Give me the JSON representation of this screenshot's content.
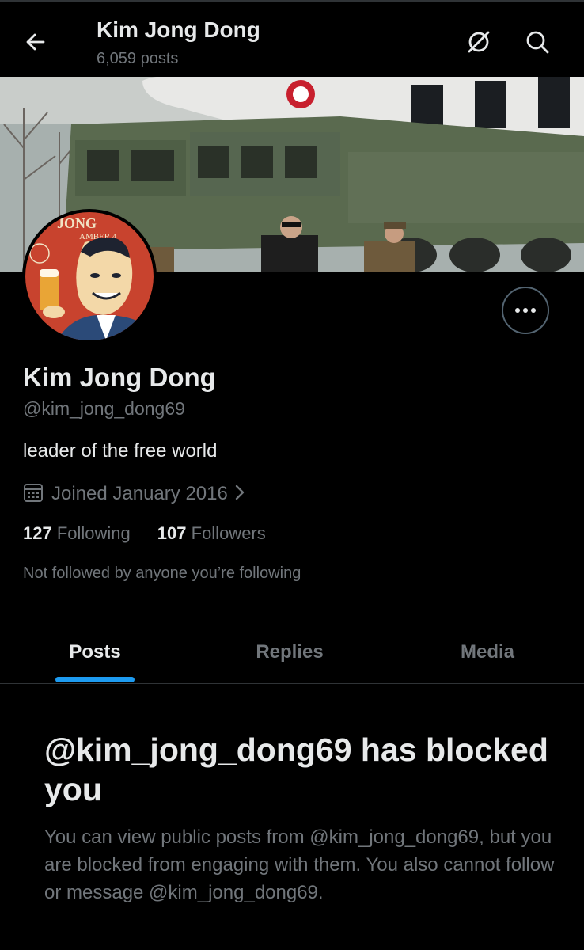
{
  "header": {
    "title": "Kim Jong Dong",
    "subtitle": "6,059 posts"
  },
  "icons": {
    "back": "arrow-left-icon",
    "grok": "grok-slash-icon",
    "search": "search-icon",
    "more": "ellipsis-icon",
    "calendar": "calendar-icon",
    "chevron": "chevron-right-icon"
  },
  "avatar": {
    "sign_text": "JONG",
    "sign_sub": "AMBER 4"
  },
  "profile": {
    "name": "Kim Jong Dong",
    "handle": "@kim_jong_dong69",
    "bio": "leader of the free world",
    "joined": "Joined January 2016",
    "following_count": "127",
    "following_label": "Following",
    "followers_count": "107",
    "followers_label": "Followers",
    "not_followed": "Not followed by anyone you’re following"
  },
  "tabs": [
    {
      "label": "Posts",
      "active": true
    },
    {
      "label": "Replies",
      "active": false
    },
    {
      "label": "Media",
      "active": false
    }
  ],
  "blocked": {
    "title": "@kim_jong_dong69 has blocked you",
    "body": "You can view public posts from @kim_jong_dong69, but you are blocked from engaging with them. You also cannot follow or message @kim_jong_dong69."
  },
  "colors": {
    "background": "#000000",
    "text_primary": "#e7e9ea",
    "text_secondary": "#71767b",
    "accent": "#1d9bf0",
    "border": "#2f3336"
  }
}
